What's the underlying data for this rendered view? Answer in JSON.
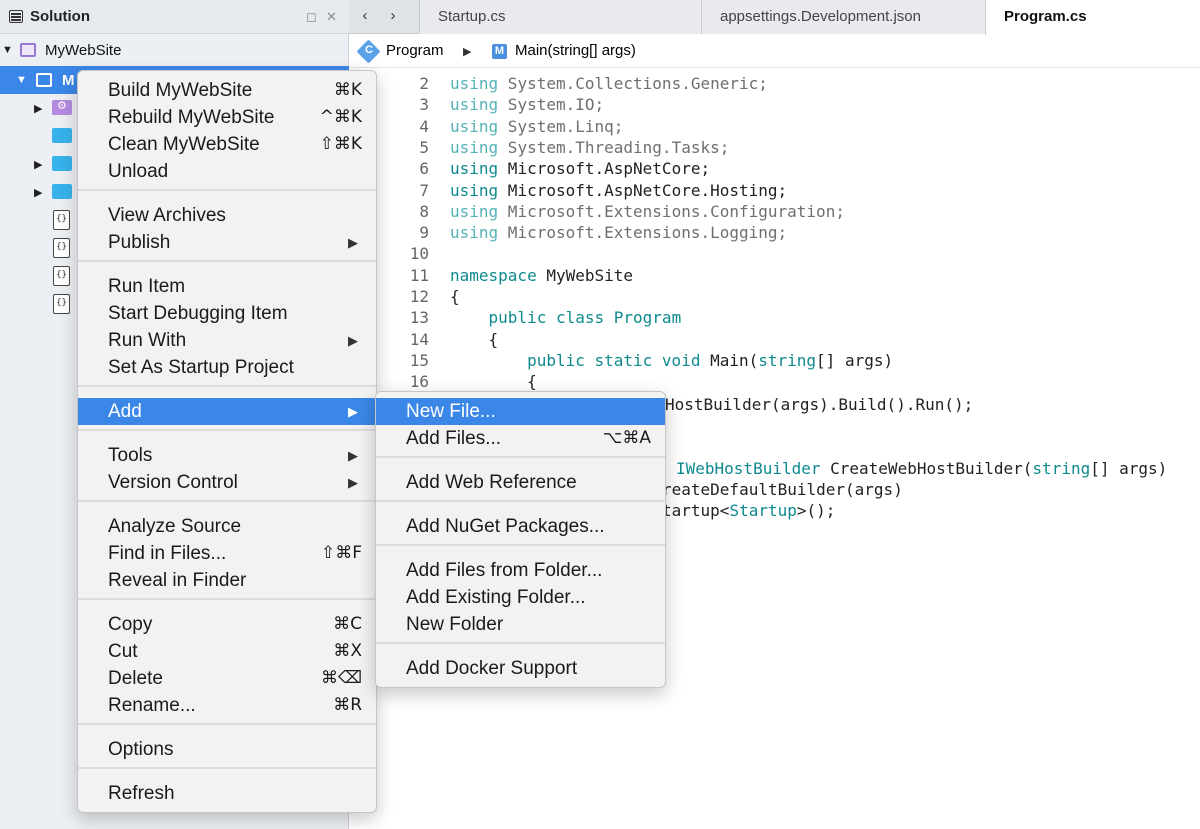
{
  "solution_pad": {
    "title": "Solution",
    "minimize_glyph": "◻",
    "close_glyph": "✕",
    "solution_name": "MyWebSite",
    "selected_project_label": "M",
    "expander_collapsed": "▶",
    "expander_expanded": "▼"
  },
  "editor": {
    "nav_back": "‹",
    "nav_forward": "›",
    "tabs": [
      "Startup.cs",
      "appsettings.Development.json",
      "Program.cs"
    ],
    "active_tab": "Program.cs",
    "breadcrumb": {
      "class_icon_letter": "C",
      "class_name": "Program",
      "separator": "▶",
      "method_icon_letter": "M",
      "method_name": "Main(string[] args)"
    }
  },
  "code_lines": [
    {
      "n": "2",
      "parts": [
        [
          "kw-dim",
          "using"
        ],
        [
          "dim",
          " System.Collections.Generic;"
        ]
      ]
    },
    {
      "n": "3",
      "parts": [
        [
          "kw-dim",
          "using"
        ],
        [
          "dim",
          " System.IO;"
        ]
      ]
    },
    {
      "n": "4",
      "parts": [
        [
          "kw-dim",
          "using"
        ],
        [
          "dim",
          " System.Linq;"
        ]
      ]
    },
    {
      "n": "5",
      "parts": [
        [
          "kw-dim",
          "using"
        ],
        [
          "dim",
          " System.Threading.Tasks;"
        ]
      ]
    },
    {
      "n": "6",
      "parts": [
        [
          "kw",
          "using"
        ],
        [
          "",
          " Microsoft.AspNetCore;"
        ]
      ]
    },
    {
      "n": "7",
      "parts": [
        [
          "kw",
          "using"
        ],
        [
          "",
          " Microsoft.AspNetCore.Hosting;"
        ]
      ]
    },
    {
      "n": "8",
      "parts": [
        [
          "kw-dim",
          "using"
        ],
        [
          "dim",
          " Microsoft.Extensions.Configuration;"
        ]
      ]
    },
    {
      "n": "9",
      "parts": [
        [
          "kw-dim",
          "using"
        ],
        [
          "dim",
          " Microsoft.Extensions.Logging;"
        ]
      ]
    },
    {
      "n": "10",
      "parts": []
    },
    {
      "n": "11",
      "parts": [
        [
          "kw",
          "namespace"
        ],
        [
          "",
          " MyWebSite"
        ]
      ]
    },
    {
      "n": "12",
      "parts": [
        [
          "",
          "{"
        ]
      ]
    },
    {
      "n": "13",
      "parts": [
        [
          "",
          "    "
        ],
        [
          "kw",
          "public class"
        ],
        [
          "",
          " "
        ],
        [
          "typ",
          "Program"
        ]
      ]
    },
    {
      "n": "14",
      "parts": [
        [
          "",
          "    {"
        ]
      ]
    },
    {
      "n": "15",
      "parts": [
        [
          "",
          "        "
        ],
        [
          "kw",
          "public static void"
        ],
        [
          "",
          " Main("
        ],
        [
          "kw",
          "string"
        ],
        [
          "",
          "[] args)"
        ]
      ]
    },
    {
      "n": "16",
      "parts": [
        [
          "",
          "        {"
        ]
      ]
    }
  ],
  "hidden_code_fragments": [
    {
      "text_parts": [
        [
          "",
          "HostBuilder(args).Build().Run();"
        ]
      ]
    },
    {
      "text_parts": [
        [
          "typ",
          "IWebHostBuilder"
        ],
        [
          "",
          " CreateWebHostBuilder("
        ],
        [
          "kw",
          "string"
        ],
        [
          "",
          "[] args)"
        ]
      ]
    },
    {
      "text_parts": [
        [
          "",
          "reateDefaultBuilder(args)"
        ]
      ]
    },
    {
      "text_parts": [
        [
          "",
          "tartup<"
        ],
        [
          "typ",
          "Startup"
        ],
        [
          "",
          ">();"
        ]
      ]
    }
  ],
  "context_menu": {
    "items": [
      {
        "label": "Build MyWebSite",
        "shortcut": "⌘K"
      },
      {
        "label": "Rebuild MyWebSite",
        "shortcut": "^⌘K"
      },
      {
        "label": "Clean MyWebSite",
        "shortcut": "⇧⌘K"
      },
      {
        "label": "Unload",
        "shortcut": ""
      },
      {
        "label": "View Archives",
        "shortcut": ""
      },
      {
        "label": "Publish",
        "shortcut": "",
        "submenu": true
      },
      {
        "label": "Run Item",
        "shortcut": ""
      },
      {
        "label": "Start Debugging Item",
        "shortcut": ""
      },
      {
        "label": "Run With",
        "shortcut": "",
        "submenu": true
      },
      {
        "label": "Set As Startup Project",
        "shortcut": ""
      },
      {
        "label": "Add",
        "shortcut": "",
        "submenu": true,
        "highlighted": true
      },
      {
        "label": "Tools",
        "shortcut": "",
        "submenu": true
      },
      {
        "label": "Version Control",
        "shortcut": "",
        "submenu": true
      },
      {
        "label": "Analyze Source",
        "shortcut": ""
      },
      {
        "label": "Find in Files...",
        "shortcut": "⇧⌘F"
      },
      {
        "label": "Reveal in Finder",
        "shortcut": ""
      },
      {
        "label": "Copy",
        "shortcut": "⌘C"
      },
      {
        "label": "Cut",
        "shortcut": "⌘X"
      },
      {
        "label": "Delete",
        "shortcut": "⌘⌫"
      },
      {
        "label": "Rename...",
        "shortcut": "⌘R"
      },
      {
        "label": "Options",
        "shortcut": ""
      },
      {
        "label": "Refresh",
        "shortcut": ""
      }
    ],
    "submenu_glyph": "▶"
  },
  "add_submenu": {
    "items": [
      {
        "label": "New File...",
        "shortcut": "",
        "highlighted": true
      },
      {
        "label": "Add Files...",
        "shortcut": "⌥⌘A"
      },
      {
        "label": "Add Web Reference",
        "shortcut": ""
      },
      {
        "label": "Add NuGet Packages...",
        "shortcut": ""
      },
      {
        "label": "Add Files from Folder...",
        "shortcut": ""
      },
      {
        "label": "Add Existing Folder...",
        "shortcut": ""
      },
      {
        "label": "New Folder",
        "shortcut": ""
      },
      {
        "label": "Add Docker Support",
        "shortcut": ""
      }
    ]
  },
  "colors": {
    "selection_blue": "#3b87e8",
    "keyword_teal": "#0e8a8e",
    "menu_background": "#f2f2f2"
  }
}
